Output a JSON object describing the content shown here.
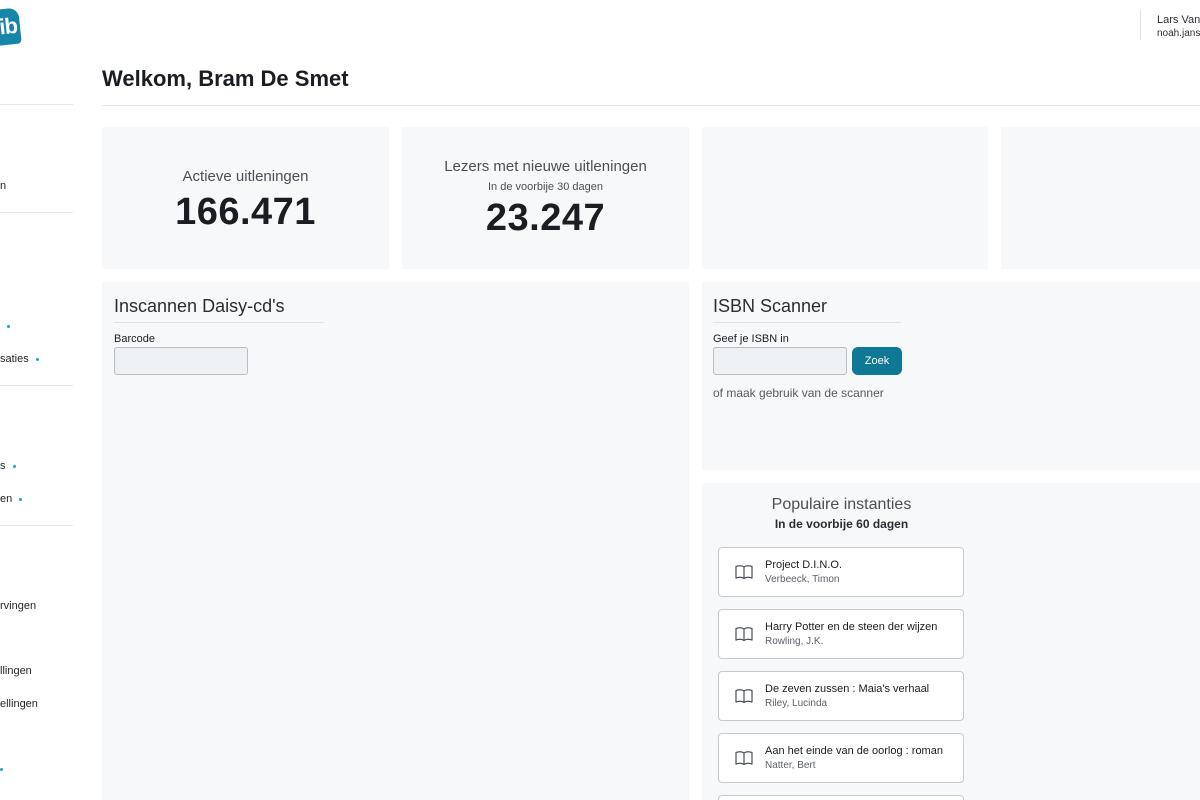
{
  "brand": {
    "logo_text": "ib"
  },
  "user": {
    "name": "Lars Vanc",
    "email": "noah.janss"
  },
  "sidebar": {
    "items": [
      {
        "label": "n",
        "dot": false
      },
      {
        "label": "saties",
        "dot": true
      },
      {
        "label": "s",
        "dot": true
      },
      {
        "label": "en",
        "dot": true
      },
      {
        "label": "rvingen",
        "dot": false
      },
      {
        "label": "llingen",
        "dot": false
      },
      {
        "label": "ellingen",
        "dot": false
      }
    ]
  },
  "header": {
    "greeting": "Welkom,",
    "user_name": "Bram De Smet"
  },
  "stats": [
    {
      "title": "Actieve uitleningen",
      "subtitle": "",
      "value": "166.471"
    },
    {
      "title": "Lezers met nieuwe uitleningen",
      "subtitle": "In de voorbije 30 dagen",
      "value": "23.247"
    }
  ],
  "daisy": {
    "title": "Inscannen Daisy-cd's",
    "barcode_label": "Barcode",
    "barcode_value": ""
  },
  "isbn": {
    "title": "ISBN Scanner",
    "input_label": "Geef je ISBN in",
    "input_value": "",
    "search_label": "Zoek",
    "hint": "of maak gebruik van de scanner"
  },
  "popular": {
    "title": "Populaire instanties",
    "subtitle": "In de voorbije 60 dagen",
    "items": [
      {
        "title": "Project D.I.N.O.",
        "author": "Verbeeck, Timon"
      },
      {
        "title": "Harry Potter en de steen der wijzen",
        "author": "Rowling, J.K."
      },
      {
        "title": "De zeven zussen : Maia's verhaal",
        "author": "Riley, Lucinda"
      },
      {
        "title": "Aan het einde van de oorlog : roman",
        "author": "Natter, Bert"
      }
    ]
  },
  "colors": {
    "accent": "#0f7895",
    "card_bg": "#f6f8fa",
    "dot": "#25a3b8"
  },
  "icons": {
    "book": "open-book-icon"
  }
}
